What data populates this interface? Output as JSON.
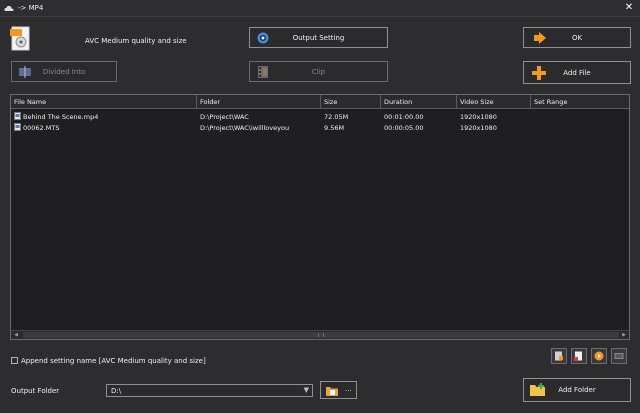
{
  "window": {
    "title": "-> MP4",
    "close_glyph": "✕"
  },
  "profile": {
    "name": "AVC Medium quality and size"
  },
  "buttons": {
    "output_setting": "Output Setting",
    "ok": "OK",
    "divided_into": "Divided Into",
    "clip": "Clip",
    "add_file": "Add File",
    "add_folder": "Add Folder"
  },
  "table": {
    "columns": [
      "File Name",
      "Folder",
      "Size",
      "Duration",
      "Video Size",
      "Set Range"
    ],
    "rows": [
      {
        "name": "Behind The Scene.mp4",
        "folder": "D:\\Project\\WAC",
        "size": "72.05M",
        "duration": "00:01:00.00",
        "video_size": "1920x1080",
        "range": ""
      },
      {
        "name": "00062.MTS",
        "folder": "D:\\Project\\WAC\\iwillloveyou",
        "size": "9.56M",
        "duration": "00:00:05.00",
        "video_size": "1920x1080",
        "range": ""
      }
    ]
  },
  "append": {
    "label": "Append setting name [AVC Medium quality and size]",
    "checked": false
  },
  "output": {
    "label": "Output Folder",
    "value": "D:\\",
    "browse_label": "..."
  },
  "icons": {
    "app": "cloud-icon",
    "profile": "video-file-icon",
    "output_setting": "gear-icon",
    "ok": "arrow-right-icon",
    "divided_into": "divide-icon",
    "clip": "film-clip-icon",
    "add_file": "plus-icon",
    "add_folder": "folder-add-icon",
    "browse": "folder-icon"
  },
  "colors": {
    "accent_orange": "#f39a1e",
    "gear_blue": "#3a8ee6",
    "background": "#2d2d30"
  }
}
